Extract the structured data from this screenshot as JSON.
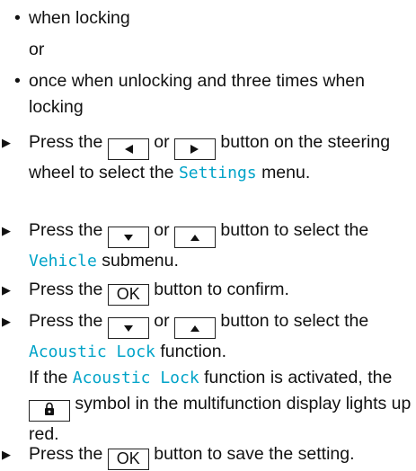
{
  "bullets": {
    "b1": "when locking",
    "or": "or",
    "b2": "once when unlocking and three times when locking"
  },
  "step1": {
    "a": "Press the",
    "or": "or",
    "b": "button on the steering wheel to select the",
    "menu": "Settings",
    "c": "menu."
  },
  "step2": {
    "a": "Press the",
    "or": "or",
    "b": "button to select the",
    "submenu": "Vehicle",
    "c": "submenu."
  },
  "step3": {
    "a": "Press the",
    "key": "OK",
    "b": "button to confirm."
  },
  "step4": {
    "a": "Press the",
    "or": "or",
    "b": "button to select the",
    "function": "Acoustic Lock",
    "c": "function.",
    "d": "If the",
    "function2": "Acoustic Lock",
    "e": "function is activated, the",
    "f": "symbol in the multifunction display lights up red."
  },
  "step5": {
    "a": "Press the",
    "key": "OK",
    "b": "button to save the setting."
  }
}
